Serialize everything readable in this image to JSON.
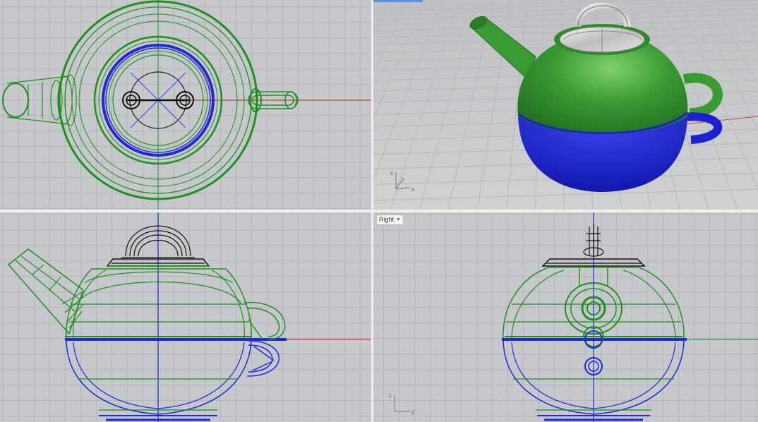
{
  "viewports": {
    "top": {
      "label": ""
    },
    "perspective": {
      "label": ""
    },
    "front": {
      "label": ""
    },
    "right": {
      "label": "Right"
    }
  },
  "axis_labels": {
    "x": "x",
    "y": "y",
    "z": "z"
  },
  "colors": {
    "viewport_bg": "#c6c8cb",
    "grid_minor": "#b3b5b8",
    "grid_major": "#a7a9ac",
    "x_axis": "#c9433f",
    "y_axis": "#3f9b3f",
    "wire_green": "#1f8f1f",
    "wire_blue": "#1f2ad6",
    "wire_black": "#111111",
    "shade_green": "#2e8a2a",
    "shade_blue": "#1a22d0",
    "shade_metal": "#d8d8d8",
    "active_tab": "#5b8fd8"
  },
  "icons": [
    "axis-triad-icon",
    "chevron-down-icon"
  ]
}
